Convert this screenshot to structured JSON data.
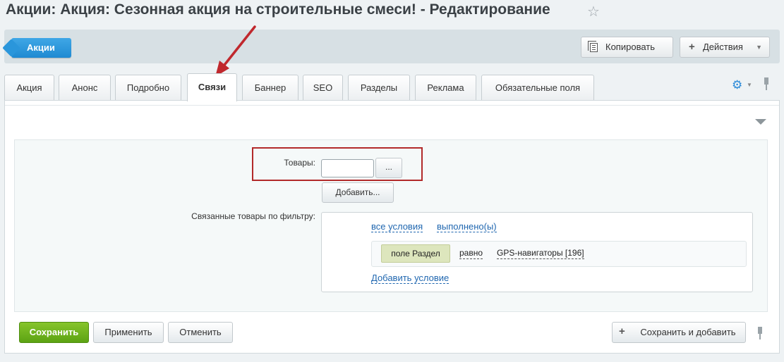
{
  "header": {
    "title": "Акции: Акция: Сезонная акция на строительные смеси! - Редактирование",
    "favorite_icon": "star-icon"
  },
  "toolbar": {
    "back_label": "Акции",
    "copy_label": "Копировать",
    "actions_label": "Действия"
  },
  "tabs": [
    {
      "label": "Акция"
    },
    {
      "label": "Анонс"
    },
    {
      "label": "Подробно"
    },
    {
      "label": "Связи",
      "active": true
    },
    {
      "label": "Баннер"
    },
    {
      "label": "SEO"
    },
    {
      "label": "Разделы"
    },
    {
      "label": "Реклама"
    },
    {
      "label": "Обязательные поля"
    }
  ],
  "form": {
    "products_label": "Товары:",
    "products_value": "",
    "browse_label": "...",
    "add_label": "Добавить...",
    "filter_label": "Связанные товары по фильтру:",
    "filter": {
      "all_conditions": "все условия",
      "fulfilled": "выполнено(ы)",
      "condition_field": "поле Раздел",
      "condition_op": "равно",
      "condition_value": "GPS-навигаторы [196]",
      "add_condition": "Добавить условие"
    }
  },
  "footer": {
    "save_label": "Сохранить",
    "apply_label": "Применить",
    "cancel_label": "Отменить",
    "save_add_label": "Сохранить и добавить"
  },
  "colors": {
    "accent_blue": "#1f8ad2",
    "save_green": "#5ca313",
    "annotation_red": "#b22a2a"
  }
}
